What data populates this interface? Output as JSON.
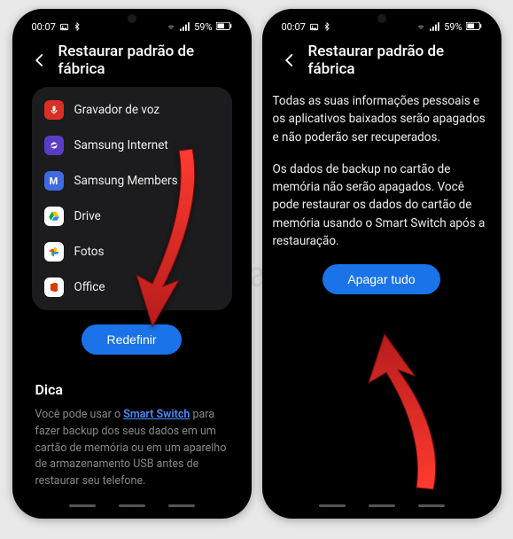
{
  "status": {
    "time": "00:07",
    "battery": "59%"
  },
  "header": {
    "title": "Restaurar padrão de fábrica"
  },
  "screen1": {
    "apps": [
      {
        "label": "Gravador de voz",
        "iconClass": "ic-voice",
        "glyph": ""
      },
      {
        "label": "Samsung Internet",
        "iconClass": "ic-internet",
        "glyph": ""
      },
      {
        "label": "Samsung Members",
        "iconClass": "ic-members",
        "glyph": "M"
      },
      {
        "label": "Drive",
        "iconClass": "ic-drive",
        "glyph": ""
      },
      {
        "label": "Fotos",
        "iconClass": "ic-fotos",
        "glyph": ""
      },
      {
        "label": "Office",
        "iconClass": "ic-office",
        "glyph": "O"
      }
    ],
    "primaryButton": "Redefinir",
    "tip": {
      "title": "Dica",
      "textBefore": "Você pode usar o ",
      "linkText": "Smart Switch",
      "textAfter": " para fazer backup dos seus dados em um cartão de memória ou em um aparelho de armazenamento USB antes de restaurar seu telefone."
    }
  },
  "screen2": {
    "paragraph1": "Todas as suas informações pessoais e os aplicativos baixados serão apagados e não poderão ser recuperados.",
    "paragraph2": "Os dados de backup no cartão de memória não serão apagados. Você pode restaurar os dados do cartão de memória usando o Smart Switch após a restauração.",
    "primaryButton": "Apagar tudo"
  },
  "watermark": "ciacomputadores.com"
}
